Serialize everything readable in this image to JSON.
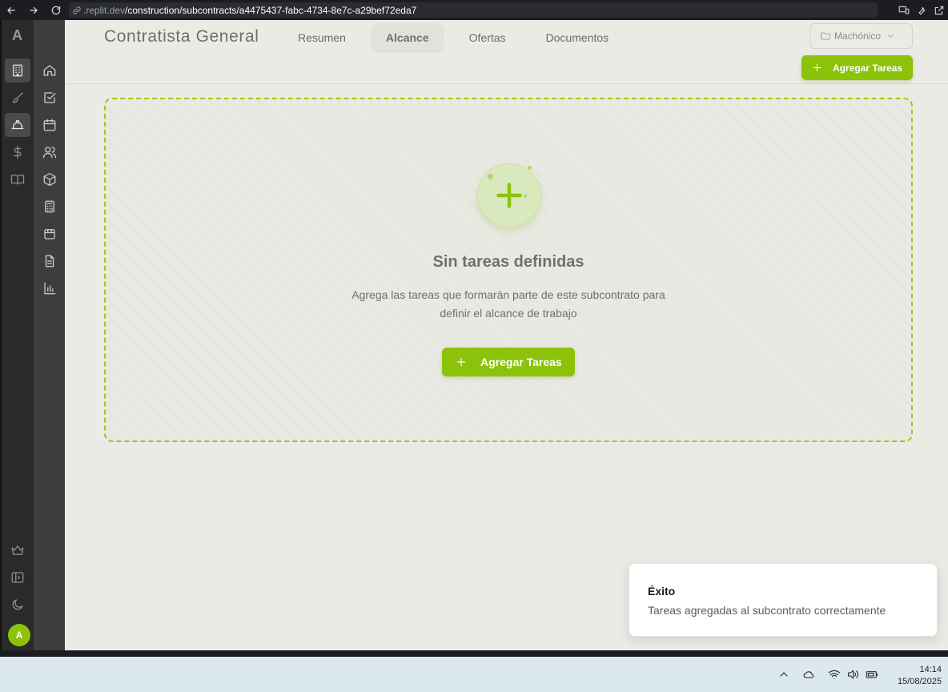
{
  "browser": {
    "url_host": ".replit.dev",
    "url_path": "/construction/subcontracts/a4475437-fabc-4734-8e7c-a29bef72eda7"
  },
  "rail": {
    "logo": "A",
    "avatar": "A"
  },
  "header": {
    "title": "Contratista General",
    "tabs": [
      {
        "label": "Resumen"
      },
      {
        "label": "Alcance"
      },
      {
        "label": "Ofertas"
      },
      {
        "label": "Documentos"
      }
    ],
    "project_select": "Machónico",
    "add_button": "Agregar Tareas"
  },
  "empty_state": {
    "title": "Sin tareas definidas",
    "description": "Agrega las tareas que formarán parte de este subcontrato para definir el alcance de trabajo",
    "add_button": "Agregar Tareas"
  },
  "toast": {
    "title": "Éxito",
    "message": "Tareas agregadas al subcontrato correctamente"
  },
  "taskbar": {
    "time": "14:14",
    "date": "15/08/2025"
  },
  "colors": {
    "accent": "#8cc20a",
    "background": "#ebebe6"
  }
}
